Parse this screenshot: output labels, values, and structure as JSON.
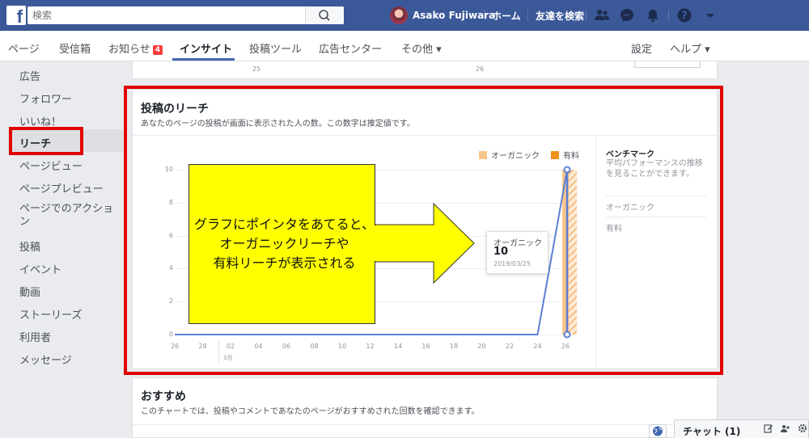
{
  "topbar": {
    "logo": "f",
    "search_placeholder": "検索",
    "user_name": "Asako Fujiwara",
    "home_label": "ホーム",
    "find_friends_label": "友達を検索",
    "icons": [
      "friends-icon",
      "messenger-icon",
      "bell-icon",
      "help-icon",
      "caret-down-icon"
    ]
  },
  "pagenav": {
    "items": [
      "ページ",
      "受信箱",
      "お知らせ",
      "インサイト",
      "投稿ツール",
      "広告センター",
      "その他 ▾"
    ],
    "notification_badge": "4",
    "active": "インサイト",
    "settings_label": "設定",
    "help_label": "ヘルプ ▾"
  },
  "sidebar": {
    "items": [
      "広告",
      "フォロワー",
      "いいね！",
      "リーチ",
      "ページビュー",
      "ページプレビュー",
      "ページでのアクショ\nン",
      "投稿",
      "イベント",
      "動画",
      "ストーリーズ",
      "利用者",
      "メッセージ"
    ],
    "active": "リーチ"
  },
  "prev_card": {
    "ticks": [
      "25",
      "26"
    ]
  },
  "reach_card": {
    "title": "投稿のリーチ",
    "subtitle": "あなたのページの投稿が画面に表示された人の数。この数字は推定値です。",
    "legend": [
      {
        "label": "オーガニック",
        "color": "#f9c68a"
      },
      {
        "label": "有料",
        "color": "#f0901c"
      }
    ],
    "benchmark_title": "ベンチマーク",
    "benchmark_desc": "平均パフォーマンスの推移を見ることができます。",
    "benchmark_items": [
      "オーガニック",
      "有料"
    ],
    "tooltip": {
      "label": "オーガニック",
      "value": "10",
      "date": "2019/03/25"
    },
    "callout_text": "グラフにポインタをあてると、\nオーガニックリーチや\n有料リーチが表示される"
  },
  "chart_data": {
    "type": "line",
    "x": [
      "26",
      "28",
      "02",
      "04",
      "06",
      "08",
      "10",
      "12",
      "14",
      "16",
      "18",
      "20",
      "22",
      "24",
      "26"
    ],
    "x_sublabel": "3月",
    "y_ticks": [
      "0",
      "2",
      "4",
      "6",
      "8",
      "10"
    ],
    "ylim": [
      0,
      10
    ],
    "series": [
      {
        "name": "オーガニック",
        "values": [
          0,
          0,
          0,
          0,
          0,
          0,
          0,
          0,
          0,
          0,
          0,
          0,
          0,
          0,
          10
        ]
      },
      {
        "name": "有料",
        "values": [
          0,
          0,
          0,
          0,
          0,
          0,
          0,
          0,
          0,
          0,
          0,
          0,
          0,
          0,
          0
        ]
      }
    ],
    "highlight": {
      "x": "2019/03/25",
      "series": "オーガニック",
      "value": 10
    },
    "grid": true,
    "legend_position": "top-right"
  },
  "recommend_card": {
    "title": "おすすめ",
    "subtitle": "このチャートでは、投稿やコメントであなたのページがおすすめされた回数を確認できます。"
  },
  "chat": {
    "label": "チャット (1)"
  },
  "colors": {
    "brand": "#3b5998",
    "highlight_red": "#e00000",
    "callout_yellow": "#ffff00",
    "line_blue": "#5b7fd6"
  }
}
